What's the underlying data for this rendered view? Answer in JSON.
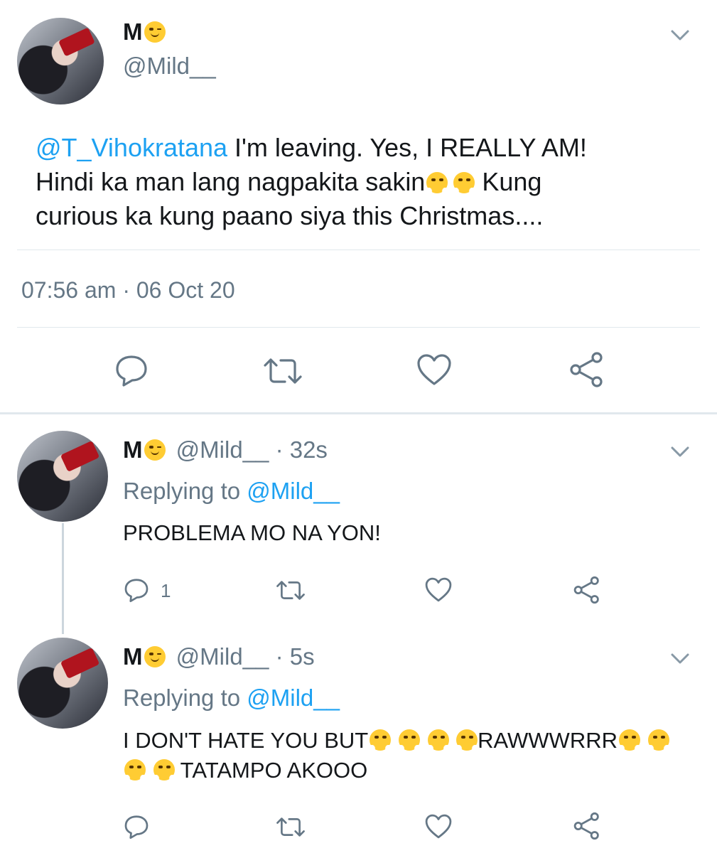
{
  "tweet": {
    "name": "M",
    "name_emoji": "winking-face",
    "handle": "@Mild__",
    "mention": "@T_Vihokratana",
    "text_line1": " I'm leaving. Yes, I REALLY AM!",
    "text_line2_a": "Hindi ka man lang nagpakita sakin",
    "text_line2_b": " Kung",
    "text_line3": "curious ka kung paano siya this Christmas....",
    "timestamp": "07:56 am · 06 Oct 20"
  },
  "replies": [
    {
      "name": "M",
      "handle": "@Mild__",
      "time": "· 32s",
      "replying_label": "Replying to",
      "replying_to": "@Mild__",
      "text": "PROBLEMA MO NA YON!",
      "reply_count": "1"
    },
    {
      "name": "M",
      "handle": "@Mild__",
      "time": "· 5s",
      "replying_label": "Replying to",
      "replying_to": "@Mild__",
      "text_a": "I DON'T HATE YOU BUT",
      "text_b": "RAWWWRRR",
      "text_c": " TATAMPO AKOOO"
    }
  ],
  "colors": {
    "link": "#1da1f2",
    "muted": "#657786",
    "divider": "#e1e8ed"
  }
}
